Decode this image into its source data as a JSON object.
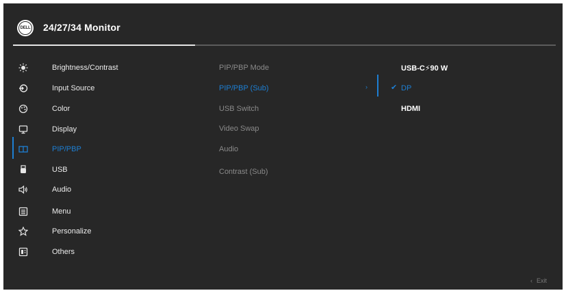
{
  "header": {
    "logo_text": "DELL",
    "title": "24/27/34 Monitor"
  },
  "menu": {
    "items": [
      {
        "label": "Brightness/Contrast",
        "icon": "brightness-icon"
      },
      {
        "label": "Input Source",
        "icon": "input-source-icon"
      },
      {
        "label": "Color",
        "icon": "color-icon"
      },
      {
        "label": "Display",
        "icon": "display-icon"
      },
      {
        "label": "PIP/PBP",
        "icon": "pip-pbp-icon",
        "active": true
      },
      {
        "label": "USB",
        "icon": "usb-icon"
      },
      {
        "label": "Audio",
        "icon": "audio-icon"
      },
      {
        "label": "Menu",
        "icon": "menu-icon"
      },
      {
        "label": "Personalize",
        "icon": "star-icon"
      },
      {
        "label": "Others",
        "icon": "others-icon"
      }
    ]
  },
  "submenu": {
    "items": [
      {
        "label": "PIP/PBP Mode"
      },
      {
        "label": "PIP/PBP (Sub)",
        "active": true
      },
      {
        "label": "USB Switch"
      },
      {
        "label": "Video Swap"
      },
      {
        "label": "Audio"
      },
      {
        "label": "Contrast (Sub)"
      }
    ],
    "chevron": "›"
  },
  "options": {
    "items": [
      {
        "label": "USB-C⚡90 W"
      },
      {
        "label": "DP",
        "selected": true
      },
      {
        "label": "HDMI"
      }
    ],
    "check": "✔"
  },
  "footer": {
    "exit_icon": "‹",
    "exit_label": "Exit"
  },
  "colors": {
    "background": "#272727",
    "accent": "#1d7fd4",
    "text": "#ececec",
    "muted": "#8a8a8a"
  }
}
